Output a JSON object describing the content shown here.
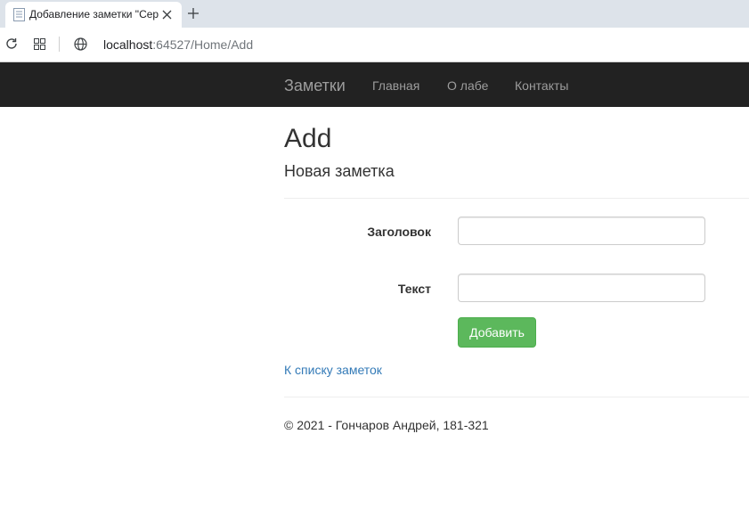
{
  "browser": {
    "tab_title": "Добавление заметки \"Сер",
    "url_host": "localhost",
    "url_rest": ":64527/Home/Add"
  },
  "navbar": {
    "brand": "Заметки",
    "links": [
      "Главная",
      "О лабе",
      "Контакты"
    ]
  },
  "page": {
    "heading": "Add",
    "subheading": "Новая заметка"
  },
  "form": {
    "title_label": "Заголовок",
    "title_value": "",
    "text_label": "Текст",
    "text_value": "",
    "submit_label": "Добавить"
  },
  "back_link": "К списку заметок",
  "footer": "© 2021 - Гончаров Андрей, 181-321",
  "colors": {
    "navbar_bg": "#222222",
    "nav_text": "#9d9d9d",
    "button_green": "#5cb85c",
    "link_blue": "#337ab7"
  },
  "icons": [
    "page-favicon-icon",
    "close-icon",
    "plus-icon",
    "reload-icon",
    "apps-icon",
    "globe-icon"
  ]
}
